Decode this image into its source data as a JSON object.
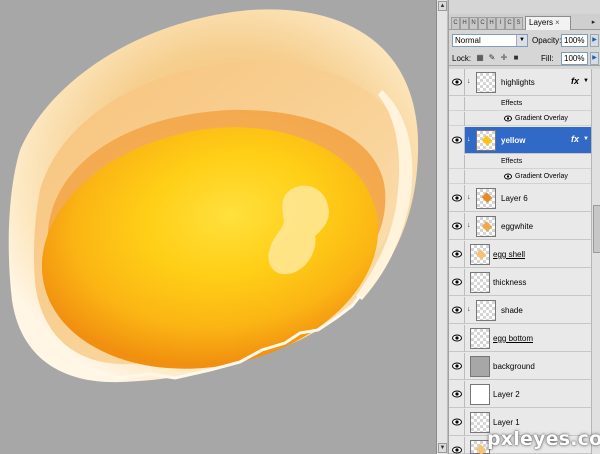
{
  "panel": {
    "mini_tabs": [
      "C",
      "H",
      "N",
      "C",
      "H",
      "I",
      "C",
      "S",
      "L"
    ],
    "active_tab": "Layers",
    "tab_close": "×",
    "menu_icon": "panel-menu-icon"
  },
  "controls": {
    "blend_mode": "Normal",
    "opacity_label": "Opacity:",
    "opacity_value": "100%",
    "lock_label": "Lock:",
    "fill_label": "Fill:",
    "fill_value": "100%"
  },
  "layers": [
    {
      "name": "highlights",
      "clip": true,
      "fx": true,
      "selected": false
    },
    {
      "effects_label": "Effects",
      "overlay_label": "Gradient Overlay"
    },
    {
      "name": "yellow",
      "clip": true,
      "fx": true,
      "selected": true
    },
    {
      "effects_label": "Effects",
      "overlay_label": "Gradient Overlay"
    },
    {
      "name": "Layer 6",
      "clip": true
    },
    {
      "name": "eggwhite",
      "clip": true
    },
    {
      "name": "egg shell"
    },
    {
      "name": "thickness"
    },
    {
      "name": "shade",
      "clip": true
    },
    {
      "name": "egg bottom"
    },
    {
      "name": "background"
    },
    {
      "name": "Layer 2"
    },
    {
      "name": "Layer 1"
    }
  ],
  "fx_label": "fx",
  "watermark": "pxleyes.com",
  "colors": {
    "canvas_bg": "#a7a7a7",
    "panel_bg": "#d6d6d6",
    "selection": "#3169c6",
    "yolk_center": "#ffd21a",
    "yolk_edge": "#f29a11",
    "shell": "#fbe3b6"
  }
}
